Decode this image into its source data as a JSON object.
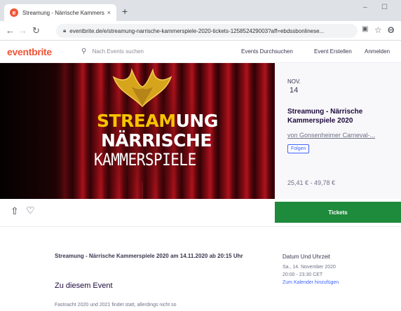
{
  "browser": {
    "tab_title": "Streamung - Närrische Kammers",
    "tab_close": "×",
    "new_tab": "+",
    "url": "eventbrite.de/e/streamung-narrische-kammerspiele-2020-tickets-125852429003?aff=ebdssbonlinese..."
  },
  "site": {
    "logo": "eventbrite",
    "search_placeholder": "Nach Events suchen",
    "nav": [
      "Events Durchsuchen",
      "Event Erstellen",
      "Anmelden"
    ]
  },
  "hero": {
    "line1_a": "STREAM",
    "line1_b": "UNG",
    "line2": "NÄRRISCHE",
    "line3": "KAMMERSPIELE"
  },
  "event": {
    "month": "NOV.",
    "day": "14",
    "title": "Streamung - Närrische Kammerspiele 2020",
    "organizer": "von Gonsenheimer Carneval-...",
    "follow_label": "Folgen",
    "price": "25,41 € - 49,78 €",
    "tickets_label": "Tickets"
  },
  "details": {
    "summary": "Streamung - Närrische Kammerspiele 2020 am 14.11.2020 ab 20:15 Uhr",
    "about_heading": "Zu diesem Event",
    "snippet": "Fastnacht 2020 und 2021 findet statt, allerdings nicht so",
    "datetime_heading": "Datum Und Uhrzeit",
    "date": "Sa., 14. November 2020",
    "time": "20:00 - 23:30 CET",
    "calendar_link": "Zum Kalender hinzufügen"
  },
  "colors": {
    "brand": "#f05537",
    "tickets": "#1e8a3c",
    "link": "#3d64ff",
    "title_yellow": "#f5c400"
  }
}
